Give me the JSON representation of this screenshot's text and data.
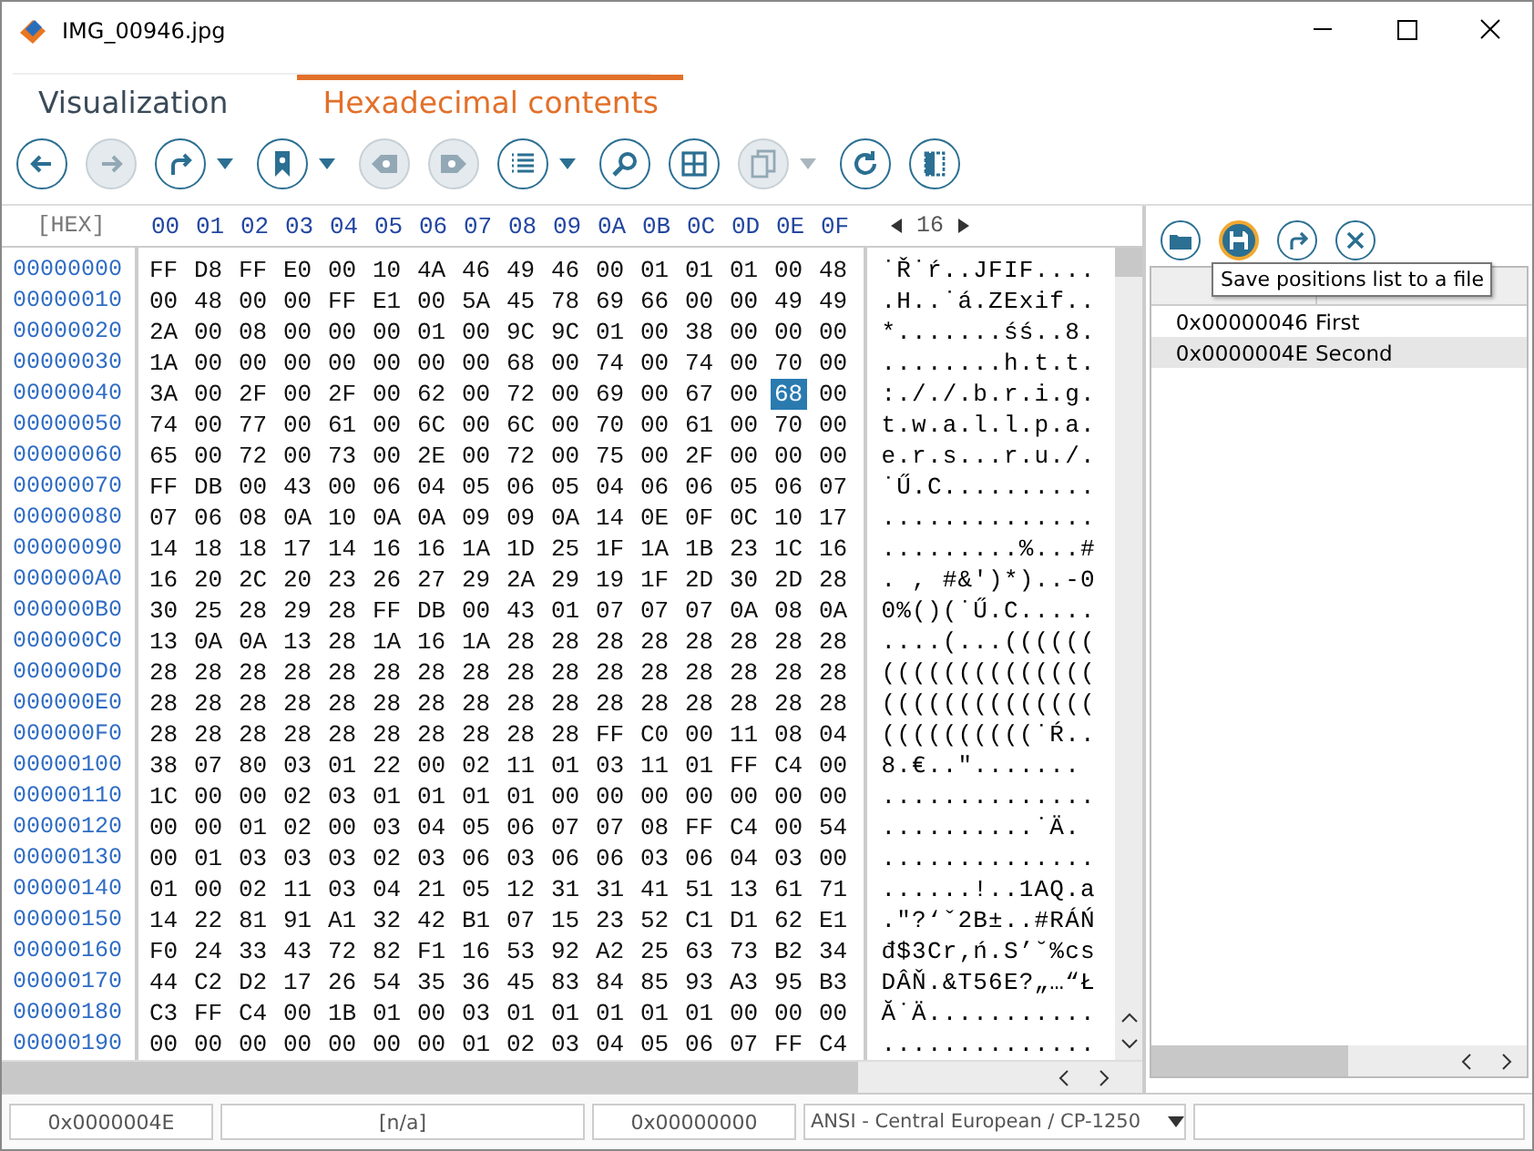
{
  "window": {
    "title": "IMG_00946.jpg"
  },
  "tabs": [
    {
      "label": "Visualization",
      "selected": false
    },
    {
      "label": "Hexadecimal contents",
      "selected": true
    }
  ],
  "toolbar": [
    {
      "disabled": false,
      "dropdown": false
    },
    {
      "disabled": true,
      "dropdown": false
    },
    {
      "disabled": false,
      "dropdown": true
    },
    {
      "disabled": false,
      "dropdown": true
    },
    {
      "disabled": true,
      "dropdown": false
    },
    {
      "disabled": true,
      "dropdown": false
    },
    {
      "disabled": false,
      "dropdown": true
    },
    {
      "disabled": false,
      "dropdown": false
    },
    {
      "disabled": false,
      "dropdown": false
    },
    {
      "disabled": true,
      "dropdown": true
    },
    {
      "disabled": false,
      "dropdown": false
    },
    {
      "disabled": false,
      "dropdown": false
    }
  ],
  "hex_view": {
    "corner_label": "[HEX]",
    "bytes_per_row": "16",
    "columns": [
      "00",
      "01",
      "02",
      "03",
      "04",
      "05",
      "06",
      "07",
      "08",
      "09",
      "0A",
      "0B",
      "0C",
      "0D",
      "0E",
      "0F"
    ],
    "rows": [
      {
        "address": "00000000",
        "bytes": [
          {
            "v": "FF",
            "selected": false
          },
          {
            "v": "D8",
            "selected": false
          },
          {
            "v": "FF",
            "selected": false
          },
          {
            "v": "E0",
            "selected": false
          },
          {
            "v": "00",
            "selected": false
          },
          {
            "v": "10",
            "selected": false
          },
          {
            "v": "4A",
            "selected": false
          },
          {
            "v": "46",
            "selected": false
          },
          {
            "v": "49",
            "selected": false
          },
          {
            "v": "46",
            "selected": false
          },
          {
            "v": "00",
            "selected": false
          },
          {
            "v": "01",
            "selected": false
          },
          {
            "v": "01",
            "selected": false
          },
          {
            "v": "01",
            "selected": false
          },
          {
            "v": "00",
            "selected": false
          },
          {
            "v": "48",
            "selected": false
          }
        ],
        "text": "˙Ř˙ŕ..JFIF...."
      },
      {
        "address": "00000010",
        "bytes": [
          {
            "v": "00",
            "selected": false
          },
          {
            "v": "48",
            "selected": false
          },
          {
            "v": "00",
            "selected": false
          },
          {
            "v": "00",
            "selected": false
          },
          {
            "v": "FF",
            "selected": false
          },
          {
            "v": "E1",
            "selected": false
          },
          {
            "v": "00",
            "selected": false
          },
          {
            "v": "5A",
            "selected": false
          },
          {
            "v": "45",
            "selected": false
          },
          {
            "v": "78",
            "selected": false
          },
          {
            "v": "69",
            "selected": false
          },
          {
            "v": "66",
            "selected": false
          },
          {
            "v": "00",
            "selected": false
          },
          {
            "v": "00",
            "selected": false
          },
          {
            "v": "49",
            "selected": false
          },
          {
            "v": "49",
            "selected": false
          }
        ],
        "text": ".H..˙á.ZExif.."
      },
      {
        "address": "00000020",
        "bytes": [
          {
            "v": "2A",
            "selected": false
          },
          {
            "v": "00",
            "selected": false
          },
          {
            "v": "08",
            "selected": false
          },
          {
            "v": "00",
            "selected": false
          },
          {
            "v": "00",
            "selected": false
          },
          {
            "v": "00",
            "selected": false
          },
          {
            "v": "01",
            "selected": false
          },
          {
            "v": "00",
            "selected": false
          },
          {
            "v": "9C",
            "selected": false
          },
          {
            "v": "9C",
            "selected": false
          },
          {
            "v": "01",
            "selected": false
          },
          {
            "v": "00",
            "selected": false
          },
          {
            "v": "38",
            "selected": false
          },
          {
            "v": "00",
            "selected": false
          },
          {
            "v": "00",
            "selected": false
          },
          {
            "v": "00",
            "selected": false
          }
        ],
        "text": "*.......śś..8."
      },
      {
        "address": "00000030",
        "bytes": [
          {
            "v": "1A",
            "selected": false
          },
          {
            "v": "00",
            "selected": false
          },
          {
            "v": "00",
            "selected": false
          },
          {
            "v": "00",
            "selected": false
          },
          {
            "v": "00",
            "selected": false
          },
          {
            "v": "00",
            "selected": false
          },
          {
            "v": "00",
            "selected": false
          },
          {
            "v": "00",
            "selected": false
          },
          {
            "v": "68",
            "selected": false
          },
          {
            "v": "00",
            "selected": false
          },
          {
            "v": "74",
            "selected": false
          },
          {
            "v": "00",
            "selected": false
          },
          {
            "v": "74",
            "selected": false
          },
          {
            "v": "00",
            "selected": false
          },
          {
            "v": "70",
            "selected": false
          },
          {
            "v": "00",
            "selected": false
          }
        ],
        "text": "........h.t.t."
      },
      {
        "address": "00000040",
        "bytes": [
          {
            "v": "3A",
            "selected": false
          },
          {
            "v": "00",
            "selected": false
          },
          {
            "v": "2F",
            "selected": false
          },
          {
            "v": "00",
            "selected": false
          },
          {
            "v": "2F",
            "selected": false
          },
          {
            "v": "00",
            "selected": false
          },
          {
            "v": "62",
            "selected": false
          },
          {
            "v": "00",
            "selected": false
          },
          {
            "v": "72",
            "selected": false
          },
          {
            "v": "00",
            "selected": false
          },
          {
            "v": "69",
            "selected": false
          },
          {
            "v": "00",
            "selected": false
          },
          {
            "v": "67",
            "selected": false
          },
          {
            "v": "00",
            "selected": false
          },
          {
            "v": "68",
            "selected": true
          },
          {
            "v": "00",
            "selected": false
          }
        ],
        "text": ":././.b.r.i.g."
      },
      {
        "address": "00000050",
        "bytes": [
          {
            "v": "74",
            "selected": false
          },
          {
            "v": "00",
            "selected": false
          },
          {
            "v": "77",
            "selected": false
          },
          {
            "v": "00",
            "selected": false
          },
          {
            "v": "61",
            "selected": false
          },
          {
            "v": "00",
            "selected": false
          },
          {
            "v": "6C",
            "selected": false
          },
          {
            "v": "00",
            "selected": false
          },
          {
            "v": "6C",
            "selected": false
          },
          {
            "v": "00",
            "selected": false
          },
          {
            "v": "70",
            "selected": false
          },
          {
            "v": "00",
            "selected": false
          },
          {
            "v": "61",
            "selected": false
          },
          {
            "v": "00",
            "selected": false
          },
          {
            "v": "70",
            "selected": false
          },
          {
            "v": "00",
            "selected": false
          }
        ],
        "text": "t.w.a.l.l.p.a."
      },
      {
        "address": "00000060",
        "bytes": [
          {
            "v": "65",
            "selected": false
          },
          {
            "v": "00",
            "selected": false
          },
          {
            "v": "72",
            "selected": false
          },
          {
            "v": "00",
            "selected": false
          },
          {
            "v": "73",
            "selected": false
          },
          {
            "v": "00",
            "selected": false
          },
          {
            "v": "2E",
            "selected": false
          },
          {
            "v": "00",
            "selected": false
          },
          {
            "v": "72",
            "selected": false
          },
          {
            "v": "00",
            "selected": false
          },
          {
            "v": "75",
            "selected": false
          },
          {
            "v": "00",
            "selected": false
          },
          {
            "v": "2F",
            "selected": false
          },
          {
            "v": "00",
            "selected": false
          },
          {
            "v": "00",
            "selected": false
          },
          {
            "v": "00",
            "selected": false
          }
        ],
        "text": "e.r.s...r.u./."
      },
      {
        "address": "00000070",
        "bytes": [
          {
            "v": "FF",
            "selected": false
          },
          {
            "v": "DB",
            "selected": false
          },
          {
            "v": "00",
            "selected": false
          },
          {
            "v": "43",
            "selected": false
          },
          {
            "v": "00",
            "selected": false
          },
          {
            "v": "06",
            "selected": false
          },
          {
            "v": "04",
            "selected": false
          },
          {
            "v": "05",
            "selected": false
          },
          {
            "v": "06",
            "selected": false
          },
          {
            "v": "05",
            "selected": false
          },
          {
            "v": "04",
            "selected": false
          },
          {
            "v": "06",
            "selected": false
          },
          {
            "v": "06",
            "selected": false
          },
          {
            "v": "05",
            "selected": false
          },
          {
            "v": "06",
            "selected": false
          },
          {
            "v": "07",
            "selected": false
          }
        ],
        "text": "˙Ű.C.........."
      },
      {
        "address": "00000080",
        "bytes": [
          {
            "v": "07",
            "selected": false
          },
          {
            "v": "06",
            "selected": false
          },
          {
            "v": "08",
            "selected": false
          },
          {
            "v": "0A",
            "selected": false
          },
          {
            "v": "10",
            "selected": false
          },
          {
            "v": "0A",
            "selected": false
          },
          {
            "v": "0A",
            "selected": false
          },
          {
            "v": "09",
            "selected": false
          },
          {
            "v": "09",
            "selected": false
          },
          {
            "v": "0A",
            "selected": false
          },
          {
            "v": "14",
            "selected": false
          },
          {
            "v": "0E",
            "selected": false
          },
          {
            "v": "0F",
            "selected": false
          },
          {
            "v": "0C",
            "selected": false
          },
          {
            "v": "10",
            "selected": false
          },
          {
            "v": "17",
            "selected": false
          }
        ],
        "text": ".............."
      },
      {
        "address": "00000090",
        "bytes": [
          {
            "v": "14",
            "selected": false
          },
          {
            "v": "18",
            "selected": false
          },
          {
            "v": "18",
            "selected": false
          },
          {
            "v": "17",
            "selected": false
          },
          {
            "v": "14",
            "selected": false
          },
          {
            "v": "16",
            "selected": false
          },
          {
            "v": "16",
            "selected": false
          },
          {
            "v": "1A",
            "selected": false
          },
          {
            "v": "1D",
            "selected": false
          },
          {
            "v": "25",
            "selected": false
          },
          {
            "v": "1F",
            "selected": false
          },
          {
            "v": "1A",
            "selected": false
          },
          {
            "v": "1B",
            "selected": false
          },
          {
            "v": "23",
            "selected": false
          },
          {
            "v": "1C",
            "selected": false
          },
          {
            "v": "16",
            "selected": false
          }
        ],
        "text": ".........%...#"
      },
      {
        "address": "000000A0",
        "bytes": [
          {
            "v": "16",
            "selected": false
          },
          {
            "v": "20",
            "selected": false
          },
          {
            "v": "2C",
            "selected": false
          },
          {
            "v": "20",
            "selected": false
          },
          {
            "v": "23",
            "selected": false
          },
          {
            "v": "26",
            "selected": false
          },
          {
            "v": "27",
            "selected": false
          },
          {
            "v": "29",
            "selected": false
          },
          {
            "v": "2A",
            "selected": false
          },
          {
            "v": "29",
            "selected": false
          },
          {
            "v": "19",
            "selected": false
          },
          {
            "v": "1F",
            "selected": false
          },
          {
            "v": "2D",
            "selected": false
          },
          {
            "v": "30",
            "selected": false
          },
          {
            "v": "2D",
            "selected": false
          },
          {
            "v": "28",
            "selected": false
          }
        ],
        "text": ". , #&')*)..-0"
      },
      {
        "address": "000000B0",
        "bytes": [
          {
            "v": "30",
            "selected": false
          },
          {
            "v": "25",
            "selected": false
          },
          {
            "v": "28",
            "selected": false
          },
          {
            "v": "29",
            "selected": false
          },
          {
            "v": "28",
            "selected": false
          },
          {
            "v": "FF",
            "selected": false
          },
          {
            "v": "DB",
            "selected": false
          },
          {
            "v": "00",
            "selected": false
          },
          {
            "v": "43",
            "selected": false
          },
          {
            "v": "01",
            "selected": false
          },
          {
            "v": "07",
            "selected": false
          },
          {
            "v": "07",
            "selected": false
          },
          {
            "v": "07",
            "selected": false
          },
          {
            "v": "0A",
            "selected": false
          },
          {
            "v": "08",
            "selected": false
          },
          {
            "v": "0A",
            "selected": false
          }
        ],
        "text": "0%()(˙Ű.C....."
      },
      {
        "address": "000000C0",
        "bytes": [
          {
            "v": "13",
            "selected": false
          },
          {
            "v": "0A",
            "selected": false
          },
          {
            "v": "0A",
            "selected": false
          },
          {
            "v": "13",
            "selected": false
          },
          {
            "v": "28",
            "selected": false
          },
          {
            "v": "1A",
            "selected": false
          },
          {
            "v": "16",
            "selected": false
          },
          {
            "v": "1A",
            "selected": false
          },
          {
            "v": "28",
            "selected": false
          },
          {
            "v": "28",
            "selected": false
          },
          {
            "v": "28",
            "selected": false
          },
          {
            "v": "28",
            "selected": false
          },
          {
            "v": "28",
            "selected": false
          },
          {
            "v": "28",
            "selected": false
          },
          {
            "v": "28",
            "selected": false
          },
          {
            "v": "28",
            "selected": false
          }
        ],
        "text": "....(...(((((("
      },
      {
        "address": "000000D0",
        "bytes": [
          {
            "v": "28",
            "selected": false
          },
          {
            "v": "28",
            "selected": false
          },
          {
            "v": "28",
            "selected": false
          },
          {
            "v": "28",
            "selected": false
          },
          {
            "v": "28",
            "selected": false
          },
          {
            "v": "28",
            "selected": false
          },
          {
            "v": "28",
            "selected": false
          },
          {
            "v": "28",
            "selected": false
          },
          {
            "v": "28",
            "selected": false
          },
          {
            "v": "28",
            "selected": false
          },
          {
            "v": "28",
            "selected": false
          },
          {
            "v": "28",
            "selected": false
          },
          {
            "v": "28",
            "selected": false
          },
          {
            "v": "28",
            "selected": false
          },
          {
            "v": "28",
            "selected": false
          },
          {
            "v": "28",
            "selected": false
          }
        ],
        "text": "(((((((((((((("
      },
      {
        "address": "000000E0",
        "bytes": [
          {
            "v": "28",
            "selected": false
          },
          {
            "v": "28",
            "selected": false
          },
          {
            "v": "28",
            "selected": false
          },
          {
            "v": "28",
            "selected": false
          },
          {
            "v": "28",
            "selected": false
          },
          {
            "v": "28",
            "selected": false
          },
          {
            "v": "28",
            "selected": false
          },
          {
            "v": "28",
            "selected": false
          },
          {
            "v": "28",
            "selected": false
          },
          {
            "v": "28",
            "selected": false
          },
          {
            "v": "28",
            "selected": false
          },
          {
            "v": "28",
            "selected": false
          },
          {
            "v": "28",
            "selected": false
          },
          {
            "v": "28",
            "selected": false
          },
          {
            "v": "28",
            "selected": false
          },
          {
            "v": "28",
            "selected": false
          }
        ],
        "text": "(((((((((((((("
      },
      {
        "address": "000000F0",
        "bytes": [
          {
            "v": "28",
            "selected": false
          },
          {
            "v": "28",
            "selected": false
          },
          {
            "v": "28",
            "selected": false
          },
          {
            "v": "28",
            "selected": false
          },
          {
            "v": "28",
            "selected": false
          },
          {
            "v": "28",
            "selected": false
          },
          {
            "v": "28",
            "selected": false
          },
          {
            "v": "28",
            "selected": false
          },
          {
            "v": "28",
            "selected": false
          },
          {
            "v": "28",
            "selected": false
          },
          {
            "v": "FF",
            "selected": false
          },
          {
            "v": "C0",
            "selected": false
          },
          {
            "v": "00",
            "selected": false
          },
          {
            "v": "11",
            "selected": false
          },
          {
            "v": "08",
            "selected": false
          },
          {
            "v": "04",
            "selected": false
          }
        ],
        "text": "((((((((((˙Ŕ.."
      },
      {
        "address": "00000100",
        "bytes": [
          {
            "v": "38",
            "selected": false
          },
          {
            "v": "07",
            "selected": false
          },
          {
            "v": "80",
            "selected": false
          },
          {
            "v": "03",
            "selected": false
          },
          {
            "v": "01",
            "selected": false
          },
          {
            "v": "22",
            "selected": false
          },
          {
            "v": "00",
            "selected": false
          },
          {
            "v": "02",
            "selected": false
          },
          {
            "v": "11",
            "selected": false
          },
          {
            "v": "01",
            "selected": false
          },
          {
            "v": "03",
            "selected": false
          },
          {
            "v": "11",
            "selected": false
          },
          {
            "v": "01",
            "selected": false
          },
          {
            "v": "FF",
            "selected": false
          },
          {
            "v": "C4",
            "selected": false
          },
          {
            "v": "00",
            "selected": false
          }
        ],
        "text": "8.€..\"......."
      },
      {
        "address": "00000110",
        "bytes": [
          {
            "v": "1C",
            "selected": false
          },
          {
            "v": "00",
            "selected": false
          },
          {
            "v": "00",
            "selected": false
          },
          {
            "v": "02",
            "selected": false
          },
          {
            "v": "03",
            "selected": false
          },
          {
            "v": "01",
            "selected": false
          },
          {
            "v": "01",
            "selected": false
          },
          {
            "v": "01",
            "selected": false
          },
          {
            "v": "01",
            "selected": false
          },
          {
            "v": "00",
            "selected": false
          },
          {
            "v": "00",
            "selected": false
          },
          {
            "v": "00",
            "selected": false
          },
          {
            "v": "00",
            "selected": false
          },
          {
            "v": "00",
            "selected": false
          },
          {
            "v": "00",
            "selected": false
          },
          {
            "v": "00",
            "selected": false
          }
        ],
        "text": ".............."
      },
      {
        "address": "00000120",
        "bytes": [
          {
            "v": "00",
            "selected": false
          },
          {
            "v": "00",
            "selected": false
          },
          {
            "v": "01",
            "selected": false
          },
          {
            "v": "02",
            "selected": false
          },
          {
            "v": "00",
            "selected": false
          },
          {
            "v": "03",
            "selected": false
          },
          {
            "v": "04",
            "selected": false
          },
          {
            "v": "05",
            "selected": false
          },
          {
            "v": "06",
            "selected": false
          },
          {
            "v": "07",
            "selected": false
          },
          {
            "v": "07",
            "selected": false
          },
          {
            "v": "08",
            "selected": false
          },
          {
            "v": "FF",
            "selected": false
          },
          {
            "v": "C4",
            "selected": false
          },
          {
            "v": "00",
            "selected": false
          },
          {
            "v": "54",
            "selected": false
          }
        ],
        "text": "..........˙Ä."
      },
      {
        "address": "00000130",
        "bytes": [
          {
            "v": "00",
            "selected": false
          },
          {
            "v": "01",
            "selected": false
          },
          {
            "v": "03",
            "selected": false
          },
          {
            "v": "03",
            "selected": false
          },
          {
            "v": "03",
            "selected": false
          },
          {
            "v": "02",
            "selected": false
          },
          {
            "v": "03",
            "selected": false
          },
          {
            "v": "06",
            "selected": false
          },
          {
            "v": "03",
            "selected": false
          },
          {
            "v": "06",
            "selected": false
          },
          {
            "v": "06",
            "selected": false
          },
          {
            "v": "03",
            "selected": false
          },
          {
            "v": "06",
            "selected": false
          },
          {
            "v": "04",
            "selected": false
          },
          {
            "v": "03",
            "selected": false
          },
          {
            "v": "00",
            "selected": false
          }
        ],
        "text": ".............."
      },
      {
        "address": "00000140",
        "bytes": [
          {
            "v": "01",
            "selected": false
          },
          {
            "v": "00",
            "selected": false
          },
          {
            "v": "02",
            "selected": false
          },
          {
            "v": "11",
            "selected": false
          },
          {
            "v": "03",
            "selected": false
          },
          {
            "v": "04",
            "selected": false
          },
          {
            "v": "21",
            "selected": false
          },
          {
            "v": "05",
            "selected": false
          },
          {
            "v": "12",
            "selected": false
          },
          {
            "v": "31",
            "selected": false
          },
          {
            "v": "31",
            "selected": false
          },
          {
            "v": "41",
            "selected": false
          },
          {
            "v": "51",
            "selected": false
          },
          {
            "v": "13",
            "selected": false
          },
          {
            "v": "61",
            "selected": false
          },
          {
            "v": "71",
            "selected": false
          }
        ],
        "text": "......!..1AQ.a"
      },
      {
        "address": "00000150",
        "bytes": [
          {
            "v": "14",
            "selected": false
          },
          {
            "v": "22",
            "selected": false
          },
          {
            "v": "81",
            "selected": false
          },
          {
            "v": "91",
            "selected": false
          },
          {
            "v": "A1",
            "selected": false
          },
          {
            "v": "32",
            "selected": false
          },
          {
            "v": "42",
            "selected": false
          },
          {
            "v": "B1",
            "selected": false
          },
          {
            "v": "07",
            "selected": false
          },
          {
            "v": "15",
            "selected": false
          },
          {
            "v": "23",
            "selected": false
          },
          {
            "v": "52",
            "selected": false
          },
          {
            "v": "C1",
            "selected": false
          },
          {
            "v": "D1",
            "selected": false
          },
          {
            "v": "62",
            "selected": false
          },
          {
            "v": "E1",
            "selected": false
          }
        ],
        "text": ".\"?‘ˇ2B±..#RÁŃ"
      },
      {
        "address": "00000160",
        "bytes": [
          {
            "v": "F0",
            "selected": false
          },
          {
            "v": "24",
            "selected": false
          },
          {
            "v": "33",
            "selected": false
          },
          {
            "v": "43",
            "selected": false
          },
          {
            "v": "72",
            "selected": false
          },
          {
            "v": "82",
            "selected": false
          },
          {
            "v": "F1",
            "selected": false
          },
          {
            "v": "16",
            "selected": false
          },
          {
            "v": "53",
            "selected": false
          },
          {
            "v": "92",
            "selected": false
          },
          {
            "v": "A2",
            "selected": false
          },
          {
            "v": "25",
            "selected": false
          },
          {
            "v": "63",
            "selected": false
          },
          {
            "v": "73",
            "selected": false
          },
          {
            "v": "B2",
            "selected": false
          },
          {
            "v": "34",
            "selected": false
          }
        ],
        "text": "đ$3Cr‚ń.S’˘%cs"
      },
      {
        "address": "00000170",
        "bytes": [
          {
            "v": "44",
            "selected": false
          },
          {
            "v": "C2",
            "selected": false
          },
          {
            "v": "D2",
            "selected": false
          },
          {
            "v": "17",
            "selected": false
          },
          {
            "v": "26",
            "selected": false
          },
          {
            "v": "54",
            "selected": false
          },
          {
            "v": "35",
            "selected": false
          },
          {
            "v": "36",
            "selected": false
          },
          {
            "v": "45",
            "selected": false
          },
          {
            "v": "83",
            "selected": false
          },
          {
            "v": "84",
            "selected": false
          },
          {
            "v": "85",
            "selected": false
          },
          {
            "v": "93",
            "selected": false
          },
          {
            "v": "A3",
            "selected": false
          },
          {
            "v": "95",
            "selected": false
          },
          {
            "v": "B3",
            "selected": false
          }
        ],
        "text": "DÂŇ.&T56E?„…“Ł"
      },
      {
        "address": "00000180",
        "bytes": [
          {
            "v": "C3",
            "selected": false
          },
          {
            "v": "FF",
            "selected": false
          },
          {
            "v": "C4",
            "selected": false
          },
          {
            "v": "00",
            "selected": false
          },
          {
            "v": "1B",
            "selected": false
          },
          {
            "v": "01",
            "selected": false
          },
          {
            "v": "00",
            "selected": false
          },
          {
            "v": "03",
            "selected": false
          },
          {
            "v": "01",
            "selected": false
          },
          {
            "v": "01",
            "selected": false
          },
          {
            "v": "01",
            "selected": false
          },
          {
            "v": "01",
            "selected": false
          },
          {
            "v": "01",
            "selected": false
          },
          {
            "v": "00",
            "selected": false
          },
          {
            "v": "00",
            "selected": false
          },
          {
            "v": "00",
            "selected": false
          }
        ],
        "text": "Ă˙Ä..........."
      },
      {
        "address": "00000190",
        "bytes": [
          {
            "v": "00",
            "selected": false
          },
          {
            "v": "00",
            "selected": false
          },
          {
            "v": "00",
            "selected": false
          },
          {
            "v": "00",
            "selected": false
          },
          {
            "v": "00",
            "selected": false
          },
          {
            "v": "00",
            "selected": false
          },
          {
            "v": "00",
            "selected": false
          },
          {
            "v": "01",
            "selected": false
          },
          {
            "v": "02",
            "selected": false
          },
          {
            "v": "03",
            "selected": false
          },
          {
            "v": "04",
            "selected": false
          },
          {
            "v": "05",
            "selected": false
          },
          {
            "v": "06",
            "selected": false
          },
          {
            "v": "07",
            "selected": false
          },
          {
            "v": "FF",
            "selected": false
          },
          {
            "v": "C4",
            "selected": false
          }
        ],
        "text": ".............."
      }
    ]
  },
  "positions_panel": {
    "tools": [
      {
        "hovered": false
      },
      {
        "hovered": true
      },
      {
        "hovered": false
      },
      {
        "hovered": false
      }
    ],
    "tooltip": "Save positions list to a file",
    "rows": [
      {
        "offset": "0x00000046",
        "comment": "First",
        "selected": false
      },
      {
        "offset": "0x0000004E",
        "comment": "Second",
        "selected": true
      }
    ]
  },
  "status_bar": {
    "offset": "0x0000004E",
    "selection": "[n/a]",
    "value": "0x00000000",
    "encoding": "ANSI - Central European / CP-1250"
  }
}
